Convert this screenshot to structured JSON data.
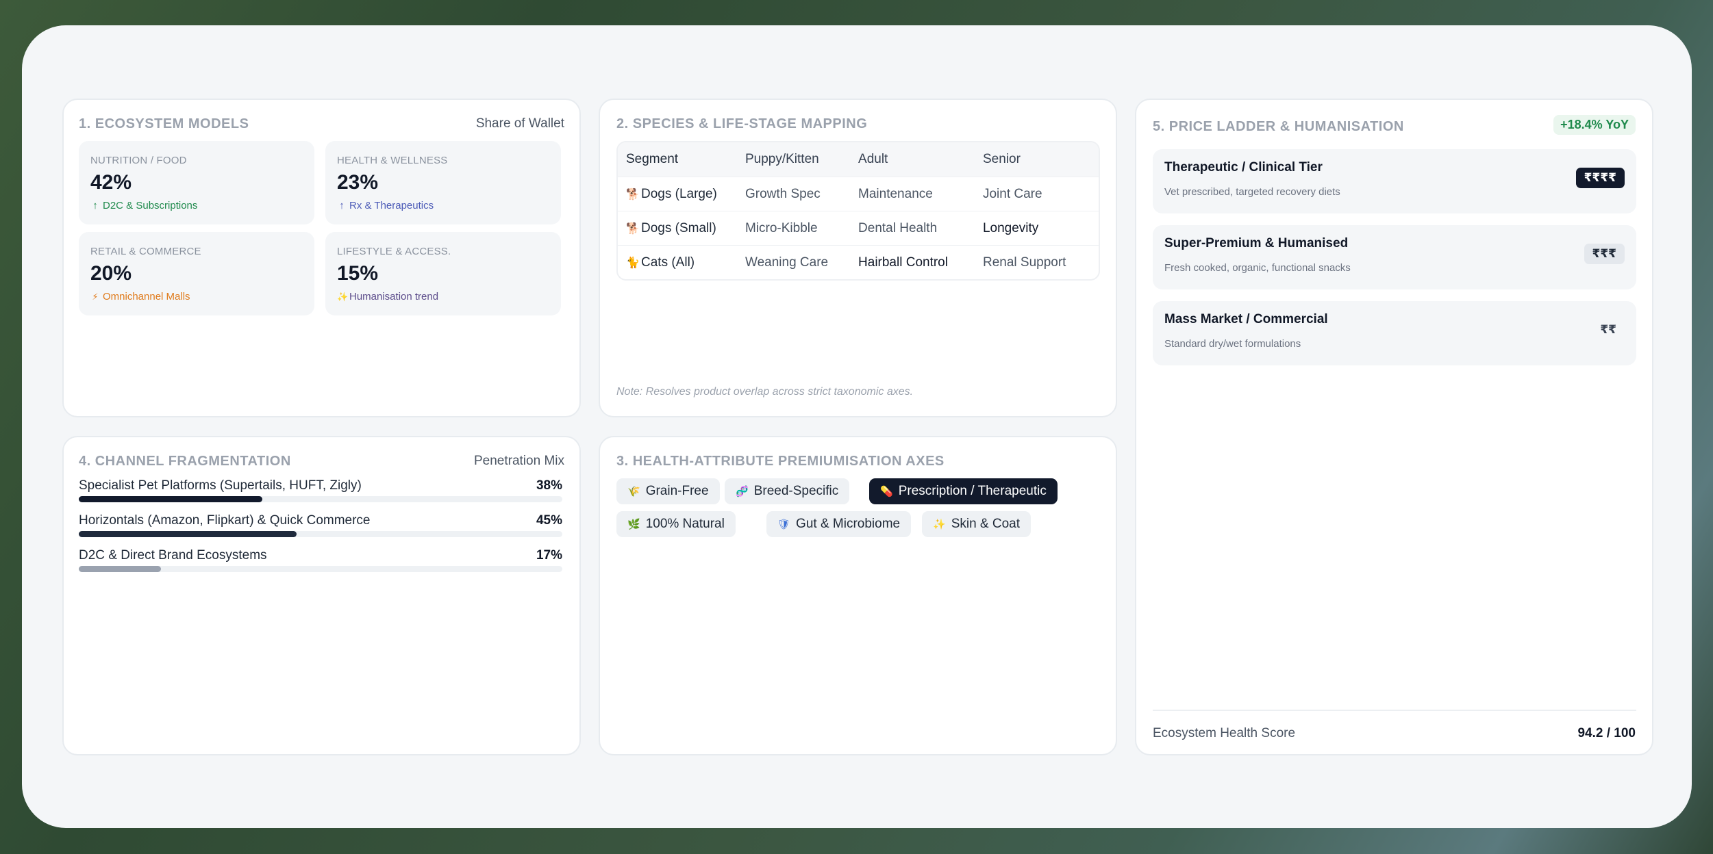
{
  "colors": {
    "dark_bar": "#121a2c",
    "mid_bar": "#1f2a3c",
    "light_bar": "#9aa2af",
    "green": "#1f8a4c",
    "blue": "#4b5ab7",
    "orange": "#e07b1c",
    "purple": "#5b4b8a"
  },
  "ecosystem": {
    "title": "1. Ecosystem Models",
    "aside": "Share of Wallet",
    "tiles": [
      {
        "label": "Nutrition / Food",
        "value": "42%",
        "note": "D2C & Subscriptions",
        "icon": "arrow-up-icon",
        "glyph": "↑"
      },
      {
        "label": "Health & Wellness",
        "value": "23%",
        "note": "Rx & Therapeutics",
        "icon": "arrow-up-icon",
        "glyph": "↑"
      },
      {
        "label": "Retail & Commerce",
        "value": "20%",
        "note": "Omnichannel Malls",
        "icon": "bolt-icon",
        "glyph": "⚡"
      },
      {
        "label": "Lifestyle & Access.",
        "value": "15%",
        "note": "Humanisation trend",
        "icon": "sparkle-icon",
        "glyph": "✨"
      }
    ]
  },
  "species": {
    "title": "2. Species & Life-Stage Mapping",
    "headers": [
      "Segment",
      "Puppy/Kitten",
      "Adult",
      "Senior"
    ],
    "rows": [
      {
        "segment": "Dogs (Large)",
        "puppy": "Growth Spec",
        "adult": "Maintenance",
        "senior": "Joint Care"
      },
      {
        "segment": "Dogs (Small)",
        "puppy": "Micro-Kibble",
        "adult": "Dental Health",
        "senior": "Longevity"
      },
      {
        "segment": "Cats (All)",
        "puppy": "Weaning Care",
        "adult": "Hairball Control",
        "senior": "Renal Support"
      }
    ],
    "note": "Note: Resolves product overlap across strict taxonomic axes."
  },
  "channel": {
    "title": "4. Channel Fragmentation",
    "aside": "Penetration Mix",
    "rows": [
      {
        "name": "Specialist Pet Platforms (Supertails, HUFT, Zigly)",
        "pct_label": "38%",
        "value": 38
      },
      {
        "name": "Horizontals (Amazon, Flipkart) & Quick Commerce",
        "pct_label": "45%",
        "value": 45
      },
      {
        "name": "D2C & Direct Brand Ecosystems",
        "pct_label": "17%",
        "value": 17
      }
    ]
  },
  "health": {
    "title": "3. Health-Attribute Premiumisation Axes",
    "chips": [
      {
        "label": "Grain-Free",
        "icon": "wheat-icon",
        "glyph": "🌾",
        "active": false
      },
      {
        "label": "Breed-Specific",
        "icon": "dna-icon",
        "glyph": "🧬",
        "active": false
      },
      {
        "label": "Prescription / Therapeutic",
        "icon": "pill-icon",
        "glyph": "💊",
        "active": true
      },
      {
        "label": "100% Natural",
        "icon": "leaf-icon",
        "glyph": "🌿",
        "active": false
      },
      {
        "label": "Gut & Microbiome",
        "icon": "shield-icon",
        "glyph": "🛡",
        "active": false
      },
      {
        "label": "Skin & Coat",
        "icon": "sparkle-icon",
        "glyph": "✨",
        "active": false
      }
    ]
  },
  "price": {
    "title": "5. Price Ladder & Humanisation",
    "yoy": "+18.4% YoY",
    "tiers": [
      {
        "name": "Therapeutic / Clinical Tier",
        "desc": "Vet prescribed, targeted recovery diets",
        "badge": "₹₹₹₹"
      },
      {
        "name": "Super-Premium & Humanised",
        "desc": "Fresh cooked, organic, functional snacks",
        "badge": "₹₹₹"
      },
      {
        "name": "Mass Market / Commercial",
        "desc": "Standard dry/wet formulations",
        "badge": "₹₹"
      }
    ],
    "score_label": "Ecosystem Health Score",
    "score_value": "94.2 / 100"
  }
}
